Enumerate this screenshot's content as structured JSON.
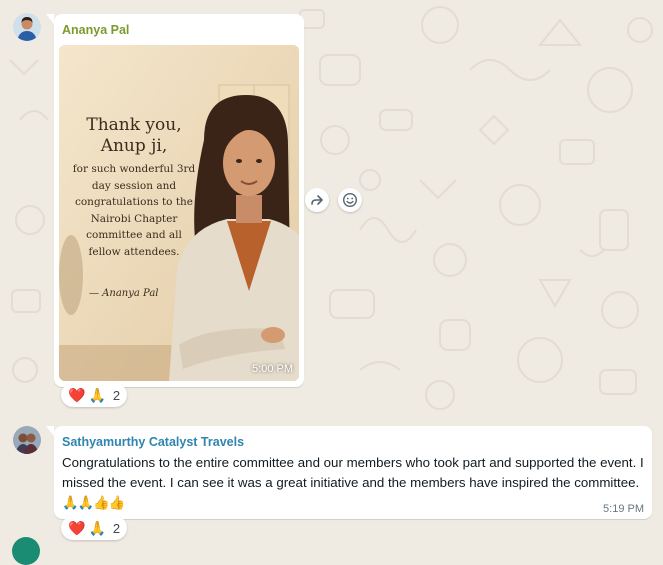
{
  "theme": {
    "chat_bg": "#efeae2",
    "bubble_bg": "#ffffff",
    "sender1_color": "#7c9a2c",
    "sender2_color": "#2f85b0",
    "time_color": "#667781"
  },
  "messages": [
    {
      "sender": "Ananya Pal",
      "type": "image",
      "image": {
        "card_title_line1": "Thank you,",
        "card_title_line2": "Anup ji,",
        "card_body": "for such wonderful 3rd day session and congratulations to the Nairobi Chapter committee and all fellow attendees.",
        "card_signature": "— Ananya Pal"
      },
      "time": "5:00 PM",
      "reactions": {
        "emojis": [
          "❤️",
          "🙏"
        ],
        "count": "2"
      }
    },
    {
      "sender": "Sathyamurthy Catalyst Travels",
      "type": "text",
      "text": "Congratulations to the entire committee and our members who took part and supported the event. I missed the event.  I can see it was a great initiative and the members have inspired the committee.",
      "emoji_run": "🙏🙏👍👍",
      "time": "5:19 PM",
      "reactions": {
        "emojis": [
          "❤️",
          "🙏"
        ],
        "count": "2"
      }
    }
  ],
  "hover_actions": {
    "forward_icon": "forward-icon",
    "react_icon": "emoji-icon"
  }
}
